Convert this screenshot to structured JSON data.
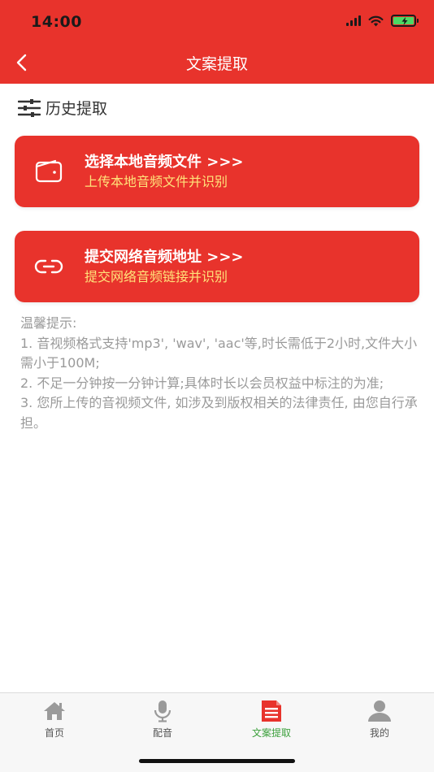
{
  "status_bar": {
    "time": "14:00"
  },
  "header": {
    "title": "文案提取"
  },
  "history": {
    "label": "历史提取"
  },
  "cards": [
    {
      "title": "选择本地音频文件 >>>",
      "subtitle": "上传本地音频文件并识别",
      "icon": "wallet-icon"
    },
    {
      "title": "提交网络音频地址 >>>",
      "subtitle": "提交网络音频链接并识别",
      "icon": "link-icon"
    }
  ],
  "tips": {
    "heading": "温馨提示:",
    "lines": [
      "1. 音视频格式支持'mp3', 'wav', 'aac'等,时长需低于2小时,文件大小需小于100M;",
      "2. 不足一分钟按一分钟计算;具体时长以会员权益中标注的为准;",
      "3. 您所上传的音视频文件, 如涉及到版权相关的法律责任, 由您自行承担。"
    ]
  },
  "tabbar": {
    "items": [
      {
        "label": "首页",
        "icon": "home-icon",
        "active": false
      },
      {
        "label": "配音",
        "icon": "microphone-icon",
        "active": false
      },
      {
        "label": "文案提取",
        "icon": "document-icon",
        "active": true
      },
      {
        "label": "我的",
        "icon": "user-icon",
        "active": false
      }
    ]
  },
  "colors": {
    "primary": "#e8332c",
    "subtitle": "#ffe27a",
    "active_tab": "#3ca03c",
    "tips_text": "#9a9a9a"
  }
}
